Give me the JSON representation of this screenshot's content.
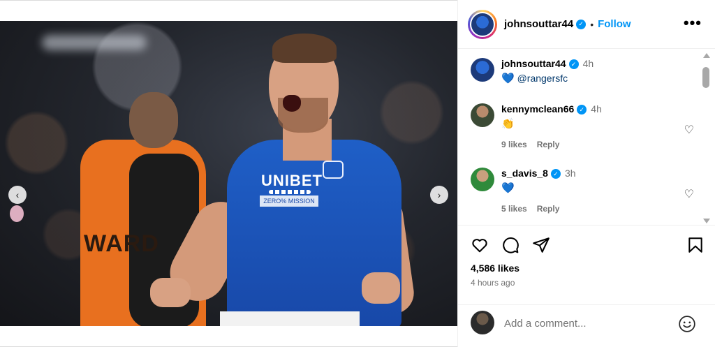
{
  "post": {
    "username": "johnsouttar44",
    "follow_label": "Follow",
    "separator": "•",
    "more_label": "•••"
  },
  "media": {
    "sponsor": "UNIBET",
    "sponsor_sub": "ZERO% MISSION",
    "steward_text": "WARD",
    "prev_arrow": "‹",
    "next_arrow": "›"
  },
  "comments": [
    {
      "username": "johnsouttar44",
      "time": "4h",
      "emoji": "💙",
      "text": "@rangersfc",
      "likes": "",
      "reply": ""
    },
    {
      "username": "kennymclean66",
      "time": "4h",
      "emoji": "👏",
      "text": "",
      "likes": "9 likes",
      "reply": "Reply"
    },
    {
      "username": "s_davis_8",
      "time": "3h",
      "emoji": "💙",
      "text": "",
      "likes": "5 likes",
      "reply": "Reply"
    }
  ],
  "stats": {
    "likes": "4,586 likes",
    "time_ago": "4 hours ago"
  },
  "composer": {
    "placeholder": "Add a comment..."
  },
  "icons": [
    "heart-icon",
    "comment-icon",
    "share-icon",
    "bookmark-icon",
    "emoji-icon",
    "verified-icon",
    "more-icon"
  ],
  "colors": {
    "accent": "#0095f6",
    "mention": "#00376b",
    "muted": "#737373",
    "shirt": "#1f5fc7"
  }
}
